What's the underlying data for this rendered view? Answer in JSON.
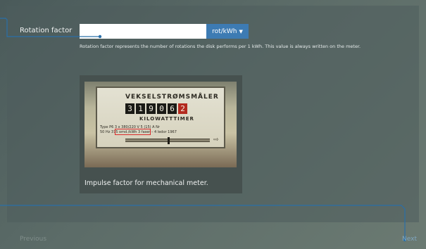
{
  "form": {
    "field_label": "Rotation factor",
    "input_value": "",
    "input_placeholder": "",
    "unit_label": "rot/kWh",
    "help_text": "Rotation factor represents the number of rotations the disk performs per 1 kWh. This value is always written on the meter."
  },
  "illustration": {
    "meter_title": "VEKSELSTRØMSMÅLER",
    "digits": [
      "3",
      "1",
      "9",
      "0",
      "6",
      "2"
    ],
    "meter_subtitle": "KILOWATTTIMER",
    "spec_line_1": "Type P6   3 x 380/220 V   5 (15) A   Nr",
    "spec_line_2": "50 Hz   375 omd./kWh   3 faser – 4 ledor   1967",
    "caption": "Impulse factor for mechanical meter."
  },
  "nav": {
    "previous_label": "Previous",
    "next_label": "Next"
  },
  "colors": {
    "accent": "#3d7bb3",
    "highlight": "#d92a2a",
    "panel": "#4e5c5c"
  }
}
